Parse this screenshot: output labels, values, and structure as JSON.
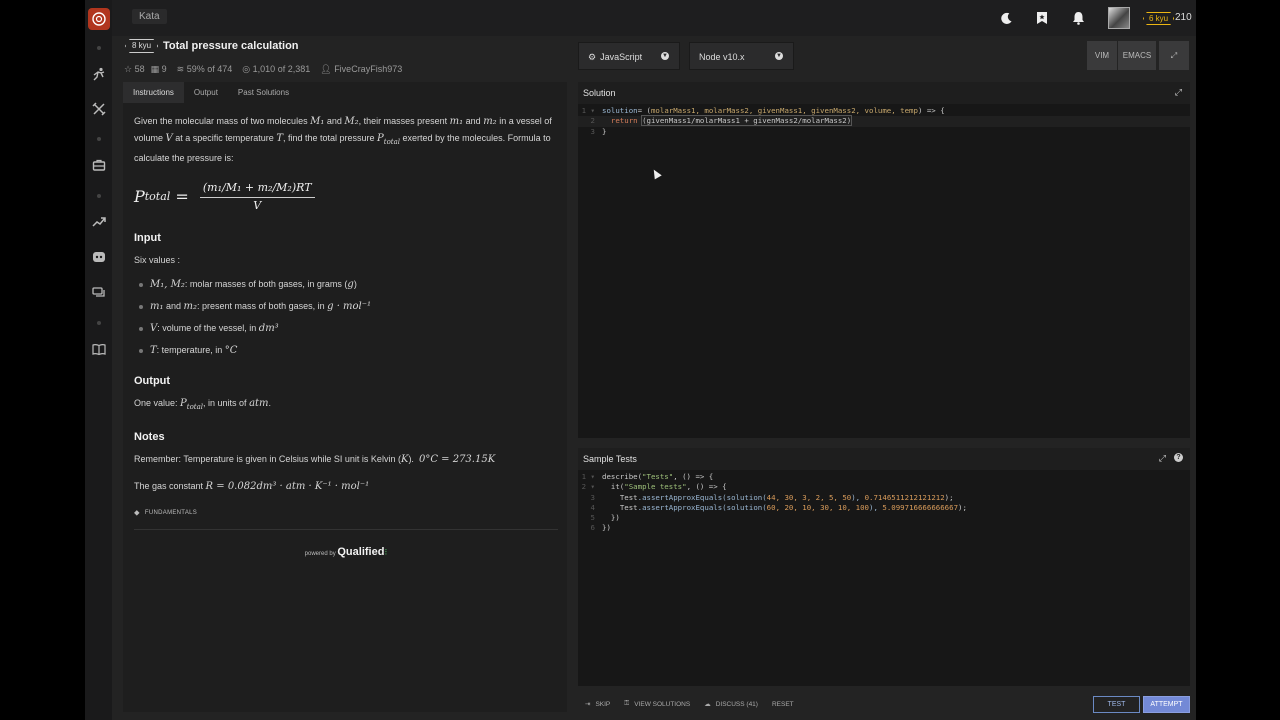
{
  "topbar": {
    "breadcrumb": "Kata",
    "icons": [
      "moon-icon",
      "bookmark-icon",
      "bell-icon"
    ],
    "rank": "6 kyu",
    "honor": "210"
  },
  "kata": {
    "rank": "8 kyu",
    "title": "Total pressure calculation",
    "stats": {
      "stars": "58",
      "collections": "9",
      "satisfaction": "59%",
      "satisfaction_of": "of 474",
      "completed": "1,010",
      "completed_of": "of 2,381",
      "author": "FiveCrayFish973"
    }
  },
  "editor_options": {
    "language": "JavaScript",
    "runtime": "Node v10.x",
    "vim_label": "VIM",
    "emacs_label": "EMACS"
  },
  "instructions": {
    "tabs": [
      "Instructions",
      "Output",
      "Past Solutions"
    ],
    "intro_1": "Given the molecular mass of two molecules ",
    "intro_M1": "M₁",
    "intro_and1": " and ",
    "intro_M2": "M₂",
    "intro_2": ", their masses present ",
    "intro_m1": "m₁",
    "intro_and2": " and ",
    "intro_m2": "m₂",
    "intro_3": " in a vessel of volume ",
    "intro_V": "V",
    "intro_4": " at a specific temperature ",
    "intro_T": "T",
    "intro_5": ", find the total pressure ",
    "intro_P": "P",
    "intro_P_sub": "total",
    "intro_6": " exerted by the molecules. Formula to calculate the pressure is:",
    "formula_lhs": "P",
    "formula_lhs_sub": "total",
    "formula_eq": " = ",
    "formula_num": "(m₁/M₁ + m₂/M₂)RT",
    "formula_den": "V",
    "input_heading": "Input",
    "input_intro": "Six values :",
    "bullets": [
      {
        "math": "M₁, M₂",
        "text": ": molar masses of both gases, in grams (",
        "unit": "g",
        "end": ")"
      },
      {
        "math": "m₁",
        "text": " and ",
        "math2": "m₂",
        "text2": ": present mass of both gases, in ",
        "unit": "g · mol⁻¹"
      },
      {
        "math": "V",
        "text": ": volume of the vessel, in ",
        "unit": "dm³"
      },
      {
        "math": "T",
        "text": ": temperature, in ",
        "unit": "°C"
      }
    ],
    "output_heading": "Output",
    "output_text_1": "One value: ",
    "output_math": "P",
    "output_math_sub": "total",
    "output_text_2": ", in units of ",
    "output_unit": "atm",
    "output_text_3": ".",
    "notes_heading": "Notes",
    "note1_text": "Remember: Temperature is given in Celsius while SI unit is Kelvin (",
    "note1_K": "K",
    "note1_end": ").",
    "note1_math": "0°C = 273.15K",
    "note2_text": "The gas constant ",
    "note2_math": "R = 0.082dm³ · atm · K⁻¹ · mol⁻¹",
    "tag": "FUNDAMENTALS",
    "powered_by": "powered by",
    "powered_brand": "Qualified"
  },
  "solution": {
    "title": "Solution",
    "line1_a": "solution",
    "line1_b": "= (",
    "line1_params": "molarMass1, molarMass2, givenMass1, givenMass2, volume, temp",
    "line1_c": ") => {",
    "line2_kw": "return",
    "line2_body": "(givenMass1/molarMass1 + givenMass2/molarMass2)",
    "line3": "}"
  },
  "tests": {
    "title": "Sample Tests",
    "help_icon": "question-icon",
    "l1_a": "describe(",
    "l1_s": "\"Tests\"",
    "l1_b": ", () => {",
    "l2_a": "it(",
    "l2_s": "\"Sample tests\"",
    "l2_b": ", () => {",
    "l3_obj": "Test",
    "l3_m": ".assertApproxEquals(solution(",
    "l3_args": "44, 30, 3, 2, 5, 50",
    "l3_m2": "), ",
    "l3_res": "0.7146511212121212",
    "l3_end": ");",
    "l4_obj": "Test",
    "l4_m": ".assertApproxEquals(solution(",
    "l4_args": "60, 20, 10, 30, 10, 100",
    "l4_m2": "), ",
    "l4_res": "5.099716666666667",
    "l4_end": ");",
    "l5": "})",
    "l6": "})"
  },
  "actions": {
    "skip": "SKIP",
    "view_solutions": "VIEW SOLUTIONS",
    "discuss": "DISCUSS (41)",
    "reset": "RESET",
    "test": "TEST",
    "attempt": "ATTEMPT"
  },
  "colors": {
    "brand_red": "#b1361e",
    "rank_yellow": "#ecb613",
    "attempt_blue": "#7389d6",
    "panel_bg": "#171717"
  }
}
